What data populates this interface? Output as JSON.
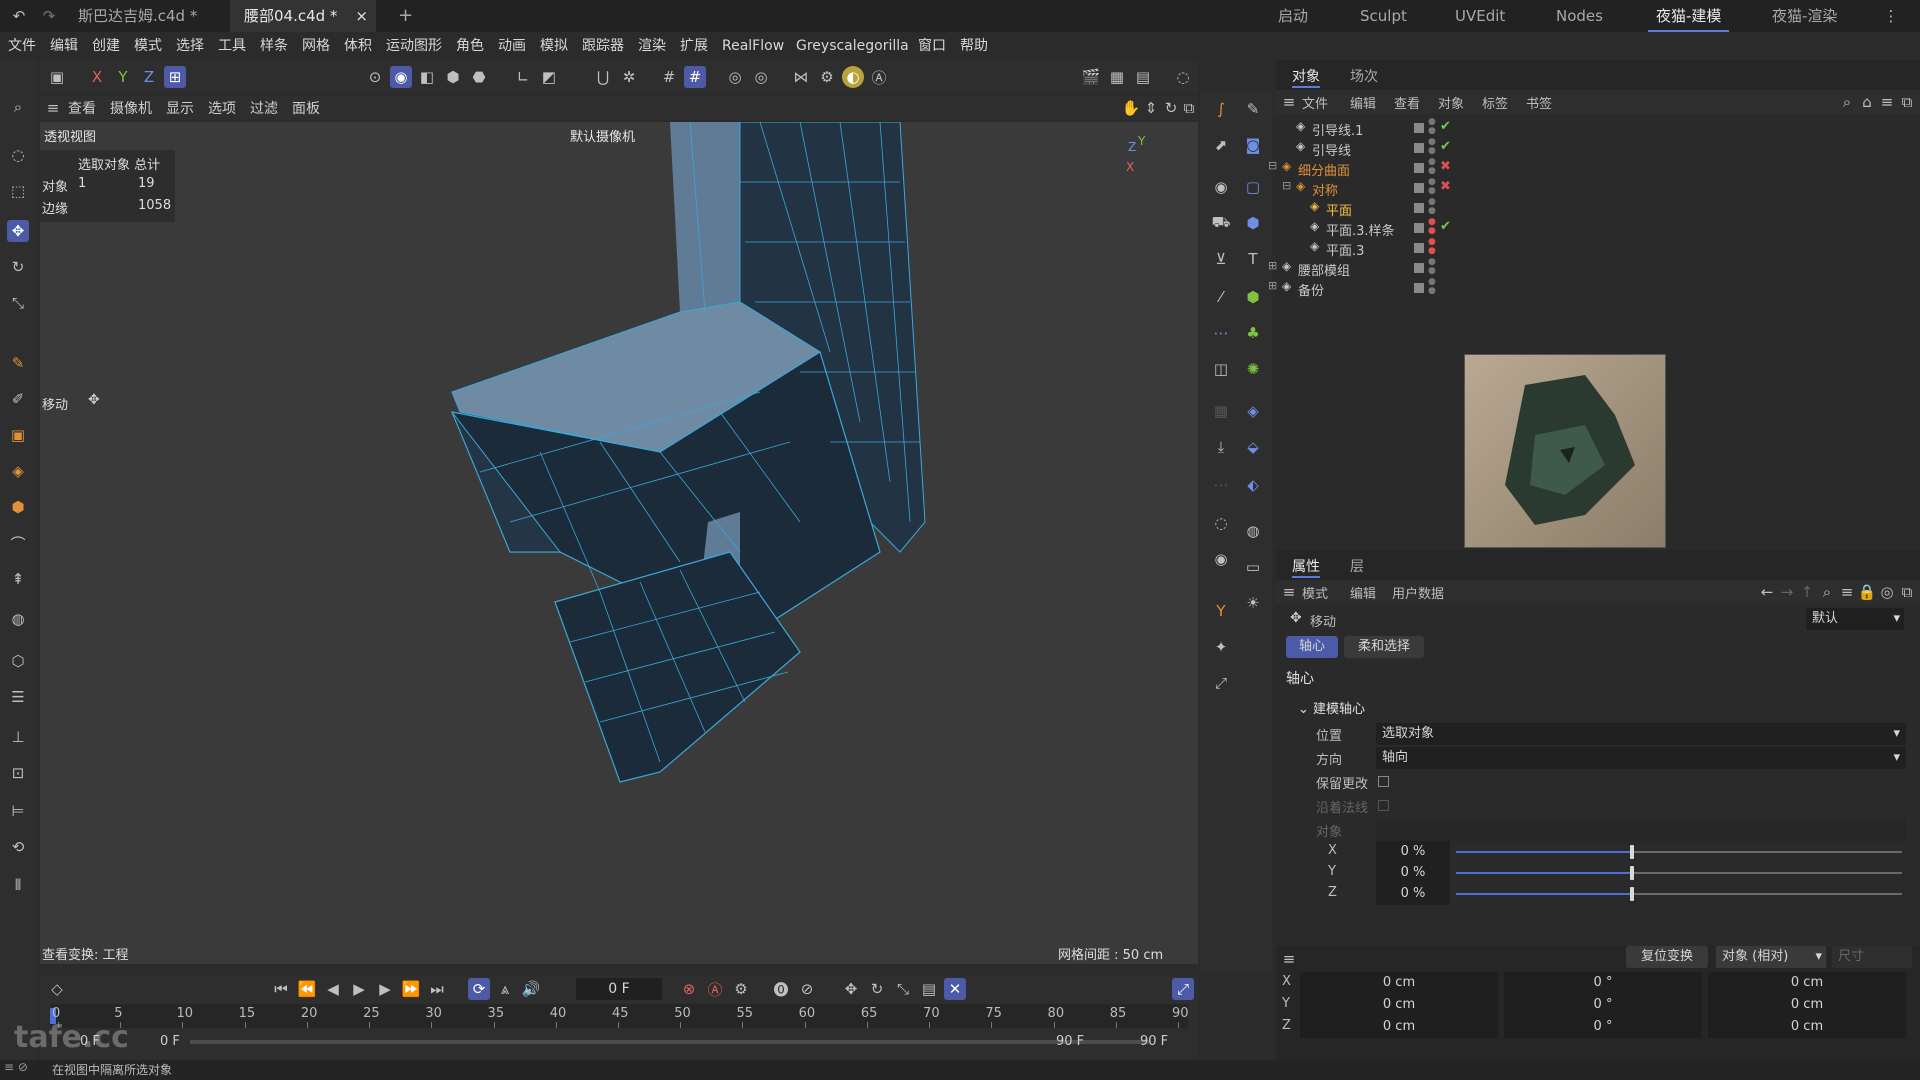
{
  "tabs": {
    "items": [
      {
        "label": "斯巴达吉姆.c4d *"
      },
      {
        "label": "腰部04.c4d *"
      }
    ],
    "close": "×",
    "add": "+"
  },
  "workspaces": {
    "items": [
      "启动",
      "Sculpt",
      "UVEdit",
      "Nodes",
      "夜猫-建模",
      "夜猫-渲染"
    ]
  },
  "menu": [
    "文件",
    "编辑",
    "创建",
    "模式",
    "选择",
    "工具",
    "样条",
    "网格",
    "体积",
    "运动图形",
    "角色",
    "动画",
    "模拟",
    "跟踪器",
    "渲染",
    "扩展",
    "RealFlow",
    "Greyscalegorilla",
    "窗口",
    "帮助"
  ],
  "axis_toggles": [
    "X",
    "Y",
    "Z"
  ],
  "viewport": {
    "menu": [
      "查看",
      "摄像机",
      "显示",
      "选项",
      "过滤",
      "面板"
    ],
    "view_name": "透视视图",
    "camera": "默认摄像机",
    "stats": {
      "header": "选取对象 总计",
      "rows": [
        {
          "label": "对象",
          "sel": "1",
          "total": "19"
        },
        {
          "label": "边缘",
          "sel": "",
          "total": "1058"
        }
      ]
    },
    "tool": "移动",
    "footer_left": "查看变换: 工程",
    "footer_right": "网格间距 : 50 cm",
    "axis": {
      "x": "X",
      "y": "Y",
      "z": "Z"
    },
    "colors": {
      "mesh_face": "#223344",
      "mesh_line": "#3aa8d8",
      "viewport_bg": "#3a3a3a"
    }
  },
  "timeline": {
    "frame": "0 F",
    "ticks": [
      "0",
      "5",
      "10",
      "15",
      "20",
      "25",
      "30",
      "35",
      "40",
      "45",
      "50",
      "55",
      "60",
      "65",
      "70",
      "75",
      "80",
      "85",
      "90"
    ],
    "start": "0 F",
    "start2": "0 F",
    "end": "90 F",
    "end2": "90 F"
  },
  "status": {
    "text": "在视图中隔离所选对象",
    "logo": "tafe.cc"
  },
  "objects": {
    "tabs": [
      "对象",
      "场次"
    ],
    "menu": [
      "文件",
      "编辑",
      "查看",
      "对象",
      "标签",
      "书签"
    ],
    "items": [
      {
        "name": "引导线.1",
        "color": "#c8c8c8",
        "state": "check"
      },
      {
        "name": "引导线",
        "color": "#c8c8c8",
        "state": "check"
      },
      {
        "name": "细分曲面",
        "color": "#e0913a",
        "state": "cross"
      },
      {
        "name": "对称",
        "color": "#e0913a",
        "state": "cross"
      },
      {
        "name": "平面",
        "color": "#f0c040",
        "state": ""
      },
      {
        "name": "平面.3.样条",
        "color": "#c8c8c8",
        "state": "check"
      },
      {
        "name": "平面.3",
        "color": "#c8c8c8",
        "state": ""
      },
      {
        "name": "腰部模组",
        "color": "#c8c8c8",
        "state": ""
      },
      {
        "name": "备份",
        "color": "#c8c8c8",
        "state": ""
      }
    ]
  },
  "attributes": {
    "tabs": [
      "属性",
      "层"
    ],
    "menu": [
      "模式",
      "编辑",
      "用户数据"
    ],
    "tool": "移动",
    "preset": "默认",
    "subtabs": [
      "轴心",
      "柔和选择"
    ],
    "section": "轴心",
    "group": "建模轴心",
    "position_label": "位置",
    "position_value": "选取对象",
    "direction_label": "方向",
    "direction_value": "轴向",
    "keep_label": "保留更改",
    "normal_label": "沿着法线",
    "object_label": "对象",
    "sliders": [
      {
        "axis": "X",
        "value": "0 %",
        "level": 0.5
      },
      {
        "axis": "Y",
        "value": "0 %",
        "level": 0.5
      },
      {
        "axis": "Z",
        "value": "0 %",
        "level": 0.5
      }
    ]
  },
  "coords": {
    "reset": "复位变换",
    "mode": "对象 (相对)",
    "size": "尺寸",
    "rows": [
      {
        "axis": "X",
        "pos": "0 cm",
        "rot": "0 °",
        "scale": "0 cm"
      },
      {
        "axis": "Y",
        "pos": "0 cm",
        "rot": "0 °",
        "scale": "0 cm"
      },
      {
        "axis": "Z",
        "pos": "0 cm",
        "rot": "0 °",
        "scale": "0 cm"
      }
    ]
  }
}
